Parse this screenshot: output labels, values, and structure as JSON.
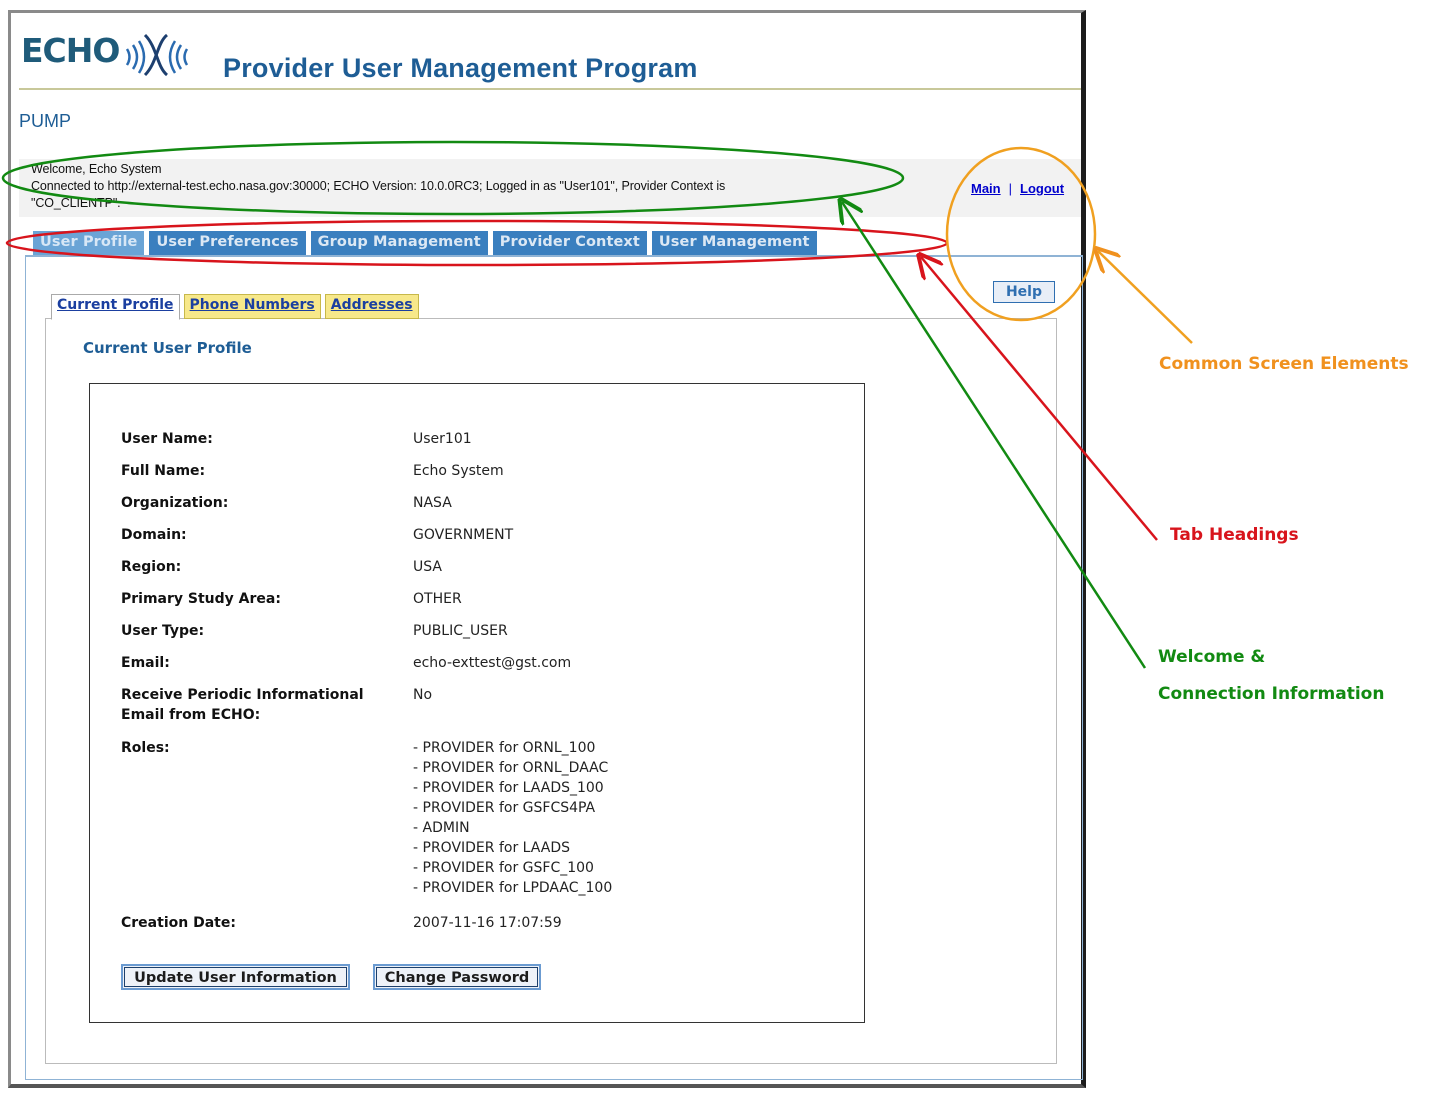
{
  "app": {
    "logo_text": "ECHO",
    "title": "Provider User Management Program",
    "short_name": "PUMP"
  },
  "welcome": {
    "line1": "Welcome, Echo System",
    "line2": "Connected to http://external-test.echo.nasa.gov:30000; ECHO Version: 10.0.0RC3; Logged in as \"User101\", Provider Context is",
    "line3": "\"CO_CLIENTP\"."
  },
  "header_links": {
    "main": "Main",
    "separator": "|",
    "logout": "Logout"
  },
  "main_tabs": [
    {
      "label": "User Profile",
      "active": true
    },
    {
      "label": "User Preferences",
      "active": false
    },
    {
      "label": "Group Management",
      "active": false
    },
    {
      "label": "Provider Context",
      "active": false
    },
    {
      "label": "User Management",
      "active": false
    }
  ],
  "help_label": "Help",
  "sub_tabs": [
    {
      "label": "Current Profile",
      "active": true
    },
    {
      "label": "Phone Numbers",
      "active": false
    },
    {
      "label": "Addresses",
      "active": false
    }
  ],
  "section_title": "Current User Profile",
  "profile": {
    "user_name": {
      "label": "User Name:",
      "value": "User101"
    },
    "full_name": {
      "label": "Full Name:",
      "value": "Echo System"
    },
    "organization": {
      "label": "Organization:",
      "value": "NASA"
    },
    "domain": {
      "label": "Domain:",
      "value": "GOVERNMENT"
    },
    "region": {
      "label": "Region:",
      "value": "USA"
    },
    "study_area": {
      "label": "Primary Study Area:",
      "value": "OTHER"
    },
    "user_type": {
      "label": "User Type:",
      "value": "PUBLIC_USER"
    },
    "email": {
      "label": "Email:",
      "value": "echo-exttest@gst.com"
    },
    "periodic_email": {
      "label_line1": "Receive Periodic Informational",
      "label_line2": "Email from ECHO:",
      "value": "No"
    },
    "roles": {
      "label": "Roles:",
      "values": [
        "- PROVIDER for ORNL_100",
        "- PROVIDER for ORNL_DAAC",
        "- PROVIDER for LAADS_100",
        "- PROVIDER for GSFCS4PA",
        "- ADMIN",
        "- PROVIDER for LAADS",
        "- PROVIDER for GSFC_100",
        "- PROVIDER for LPDAAC_100"
      ]
    },
    "creation_date": {
      "label": "Creation Date:",
      "value": "2007-11-16 17:07:59"
    }
  },
  "buttons": {
    "update": "Update User Information",
    "change_password": "Change Password"
  },
  "annotations": {
    "common": {
      "text": "Common Screen Elements",
      "color": "#f0911e"
    },
    "tabs": {
      "text": "Tab Headings",
      "color": "#d8141c"
    },
    "welcome_line1": {
      "text": "Welcome &",
      "color": "#128a12"
    },
    "welcome_line2": {
      "text": "Connection Information",
      "color": "#128a12"
    }
  }
}
